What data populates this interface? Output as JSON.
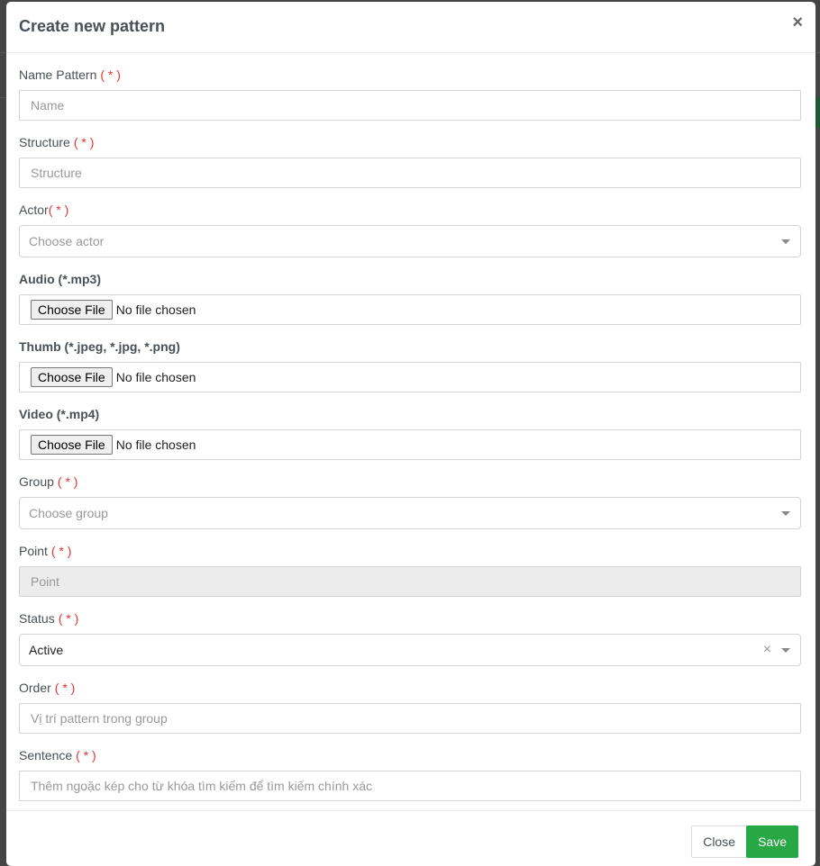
{
  "modal": {
    "title": "Create new pattern",
    "close_icon": "×",
    "required_marker": "( * )",
    "required_marker_tight": "( * )"
  },
  "fields": {
    "name": {
      "label": "Name Pattern",
      "placeholder": "Name",
      "value": ""
    },
    "structure": {
      "label": "Structure",
      "placeholder": "Structure",
      "value": ""
    },
    "actor": {
      "label": "Actor",
      "placeholder": "Choose actor"
    },
    "audio": {
      "label": "Audio (*.mp3)",
      "button": "Choose File",
      "status": "No file chosen"
    },
    "thumb": {
      "label": "Thumb (*.jpeg, *.jpg, *.png)",
      "button": "Choose File",
      "status": "No file chosen"
    },
    "video": {
      "label": "Video (*.mp4)",
      "button": "Choose File",
      "status": "No file chosen"
    },
    "group": {
      "label": "Group",
      "placeholder": "Choose group"
    },
    "point": {
      "label": "Point",
      "placeholder": "Point",
      "value": ""
    },
    "status": {
      "label": "Status",
      "value": "Active",
      "clear_icon": "×"
    },
    "order": {
      "label": "Order",
      "placeholder": "Vị trí pattern trong group",
      "value": ""
    },
    "sentence": {
      "label": "Sentence",
      "placeholder": "Thêm ngoặc kép cho từ khóa tìm kiếm để tìm kiếm chính xác",
      "value": ""
    }
  },
  "footer": {
    "close_label": "Close",
    "save_label": "Save"
  },
  "colors": {
    "required": "#e3342f",
    "save": "#28a745"
  }
}
